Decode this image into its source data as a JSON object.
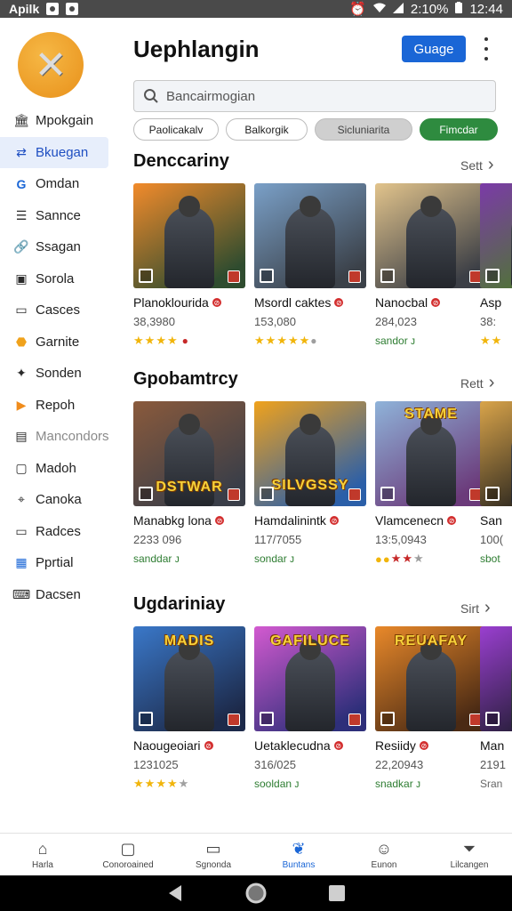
{
  "status_bar": {
    "app_name": "Apilk",
    "battery": "2:10%",
    "time": "12:44"
  },
  "sidebar": {
    "logo_icon": "x-logo-icon",
    "items": [
      {
        "label": "Mpokgain",
        "icon": "building-icon"
      },
      {
        "label": "Bkuegan",
        "icon": "swap-icon",
        "active": true
      },
      {
        "label": "Omdan",
        "icon": "g-icon"
      },
      {
        "label": "Sannce",
        "icon": "list-icon"
      },
      {
        "label": "Ssagan",
        "icon": "link-icon"
      },
      {
        "label": "Sorola",
        "icon": "window-icon"
      },
      {
        "label": "Casces",
        "icon": "chat-icon"
      },
      {
        "label": "Garnite",
        "icon": "shield-icon"
      },
      {
        "label": "Sonden",
        "icon": "wolf-icon"
      },
      {
        "label": "Repoh",
        "icon": "play-icon"
      },
      {
        "label": "Mancondors",
        "icon": "pages-icon",
        "muted": true
      },
      {
        "label": "Madoh",
        "icon": "tv-icon"
      },
      {
        "label": "Canoka",
        "icon": "pin-icon"
      },
      {
        "label": "Radces",
        "icon": "card-icon"
      },
      {
        "label": "Pprtial",
        "icon": "grid-icon"
      },
      {
        "label": "Dacsen",
        "icon": "keyboard-icon"
      }
    ]
  },
  "header": {
    "title": "Uephlangin",
    "cta_label": "Guage"
  },
  "search": {
    "placeholder": "Bancairmogian"
  },
  "chips": [
    "Paolicakalv",
    "Balkorgik",
    "Sicluniarita",
    "Fimcdar"
  ],
  "sections": [
    {
      "title": "Denccariny",
      "link": "Sett",
      "cards": [
        {
          "name": "Planoklourida",
          "meta": "38,3980",
          "foot_type": "stars",
          "stars": 4,
          "extra": "red-drop",
          "colors": [
            "#f28b2b",
            "#2f4c2f"
          ]
        },
        {
          "name": "Msordl caktes",
          "meta": "153,080",
          "foot_type": "stars",
          "stars": 5,
          "extra": "gray-dot",
          "colors": [
            "#7aa0c8",
            "#3b4149"
          ]
        },
        {
          "name": "Nanocbal",
          "meta": "284,023",
          "foot_type": "text",
          "foot": "sandor ᴊ",
          "colors": [
            "#e2c48c",
            "#3c3f46"
          ]
        },
        {
          "name": "Asp",
          "meta": "38:",
          "foot_type": "stars",
          "stars": 2,
          "colors": [
            "#7b3aa8",
            "#4b7a2a"
          ]
        }
      ]
    },
    {
      "title": "Gpobamtrcy",
      "link": "Rett",
      "cards": [
        {
          "name": "Manabkg lona",
          "meta": "2233 096",
          "foot_type": "text",
          "foot": "sanddar ᴊ",
          "colors": [
            "#8a5a3c",
            "#3a3e48"
          ],
          "banner": "DSTWAR"
        },
        {
          "name": "Hamdalinintk",
          "meta": "117/7055",
          "foot_type": "text",
          "foot": "sondar ᴊ",
          "colors": [
            "#f0a21c",
            "#2b5fa8"
          ],
          "banner": "SILVGSSY"
        },
        {
          "name": "Vlamcenecn",
          "meta": "13:5,0943",
          "foot_type": "dots",
          "colors": [
            "#8fb3d9",
            "#6b3a7a"
          ],
          "banner": "STAME"
        },
        {
          "name": "San",
          "meta": "100(",
          "foot_type": "text",
          "foot": "sbot",
          "colors": [
            "#d9a44a",
            "#1b1b1b"
          ]
        }
      ]
    },
    {
      "title": "Ugdariniay",
      "link": "Sirt",
      "cards": [
        {
          "name": "Naougeoiari",
          "meta": "1231025",
          "foot_type": "stars",
          "stars": 4,
          "colors": [
            "#3a78c9",
            "#1d2a4a"
          ],
          "banner": "MADIS"
        },
        {
          "name": "Uetaklecudna",
          "meta": "316/025",
          "foot_type": "text",
          "foot": "sooldan ᴊ",
          "colors": [
            "#d35ad0",
            "#2e2f7a"
          ],
          "banner": "GAFILUCE"
        },
        {
          "name": "Resiidy",
          "meta": "22,20943",
          "foot_type": "text",
          "foot": "snadkar ᴊ",
          "colors": [
            "#e9892a",
            "#4a2a14"
          ],
          "banner": "REUAFAY"
        },
        {
          "name": "Man",
          "meta": "2191",
          "foot_type": "text",
          "foot": "Sran",
          "colors": [
            "#9a3fd0",
            "#1b1b2a"
          ]
        }
      ]
    }
  ],
  "bottom_nav": [
    {
      "label": "Harla",
      "icon": "home-icon"
    },
    {
      "label": "Conoroained",
      "icon": "square-icon"
    },
    {
      "label": "Sgnonda",
      "icon": "window-icon"
    },
    {
      "label": "Buntans",
      "icon": "bird-icon",
      "active": true
    },
    {
      "label": "Eunon",
      "icon": "person-icon"
    },
    {
      "label": "Lilcangen",
      "icon": "filter-icon"
    }
  ],
  "system_nav": [
    "back-icon",
    "home-circle-icon",
    "recents-icon"
  ]
}
